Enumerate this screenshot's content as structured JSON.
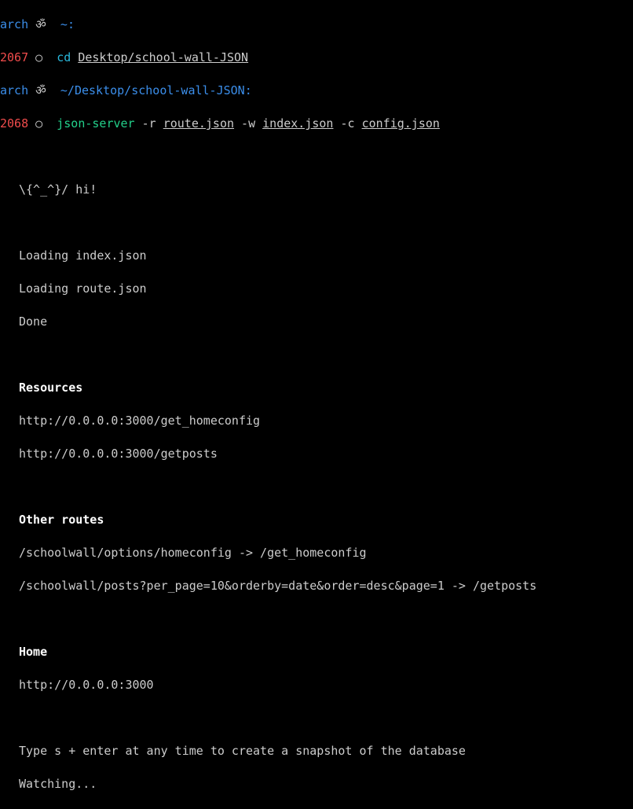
{
  "prompt1": {
    "host": "arch",
    "symbol": "ॐ",
    "path": "~",
    "colon": ":"
  },
  "prompt2": {
    "histnum": "2067",
    "ring": "○",
    "cmd": "cd",
    "arg": "Desktop/school-wall-JSON"
  },
  "prompt3": {
    "host": "arch",
    "symbol": "ॐ",
    "path": "~/Desktop/school-wall-JSON",
    "colon": ":"
  },
  "prompt4": {
    "histnum": "2068",
    "ring": "○",
    "cmd": "json-server",
    "flag_r": " -r ",
    "route": "route.json",
    "flag_w": " -w ",
    "index": "index.json",
    "flag_c": " -c ",
    "config": "config.json"
  },
  "output": {
    "greet": "\\{^_^}/ hi!",
    "load1": "Loading index.json",
    "load2": "Loading route.json",
    "done": "Done",
    "resources_hdr": "Resources",
    "res1": "http://0.0.0.0:3000/get_homeconfig",
    "res2": "http://0.0.0.0:3000/getposts",
    "other_hdr": "Other routes",
    "other1": "/schoolwall/options/homeconfig -> /get_homeconfig",
    "other2": "/schoolwall/posts?per_page=10&orderby=date&order=desc&page=1 -> /getposts",
    "home_hdr": "Home",
    "home_url": "http://0.0.0.0:3000",
    "tip": "Type s + enter at any time to create a snapshot of the database",
    "watching": "Watching..."
  }
}
